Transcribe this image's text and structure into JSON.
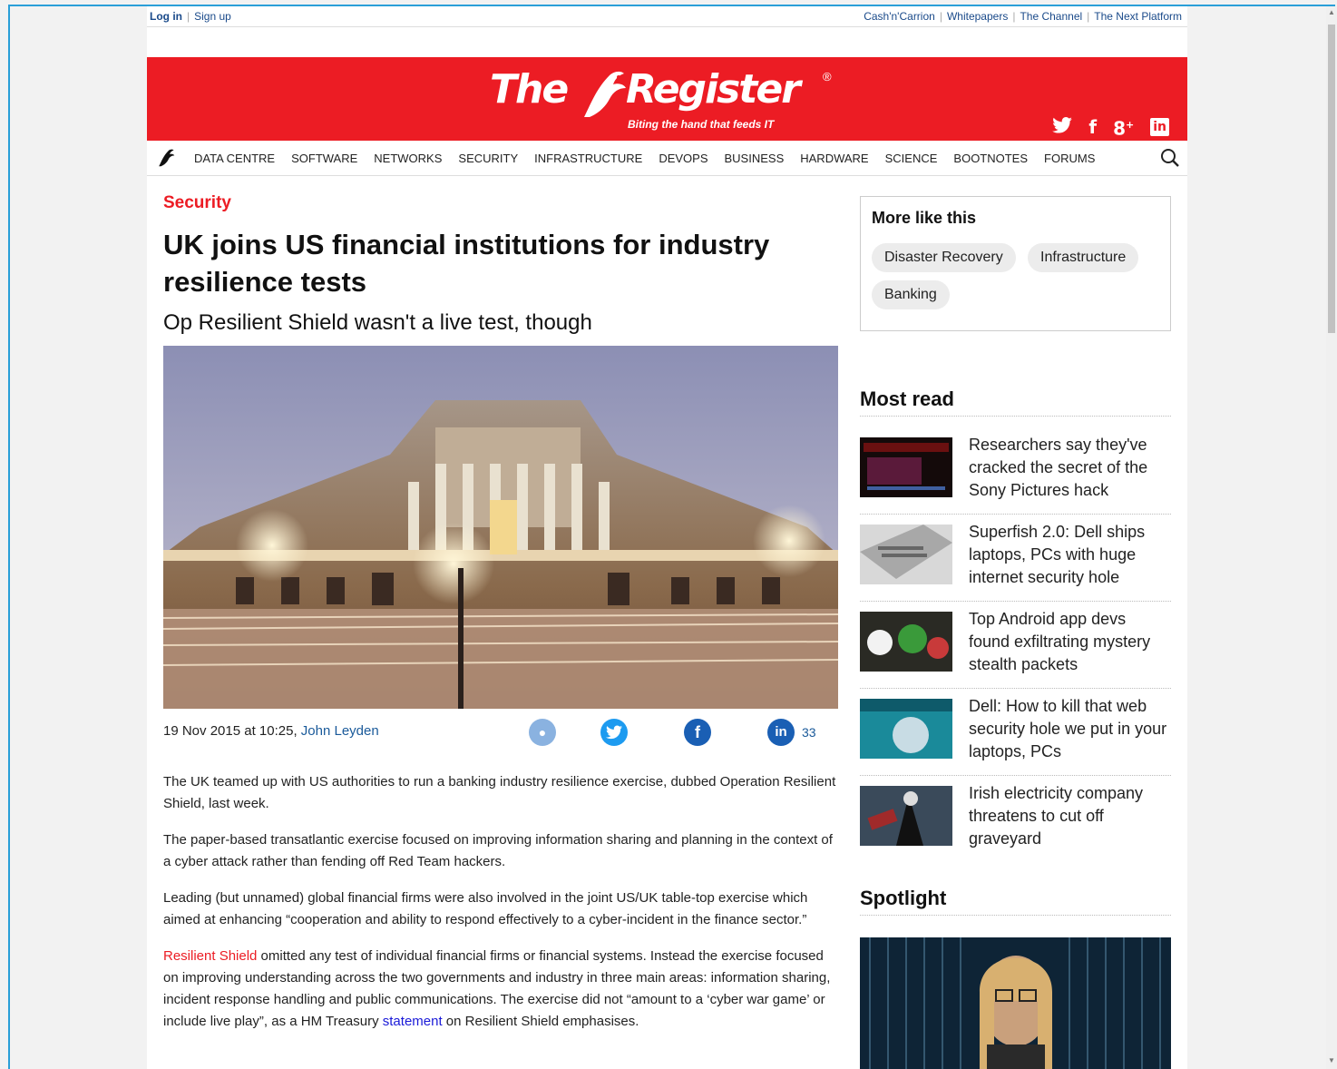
{
  "topbar": {
    "login": "Log in",
    "signup": "Sign up",
    "links": [
      "Cash'n'Carrion",
      "Whitepapers",
      "The Channel",
      "The Next Platform"
    ]
  },
  "logo": {
    "word_the": "The",
    "word_register": "Register",
    "registered": "®",
    "tagline": "Biting the hand that feeds IT"
  },
  "nav": {
    "items": [
      "DATA CENTRE",
      "SOFTWARE",
      "NETWORKS",
      "SECURITY",
      "INFRASTRUCTURE",
      "DEVOPS",
      "BUSINESS",
      "HARDWARE",
      "SCIENCE",
      "BOOTNOTES",
      "FORUMS"
    ]
  },
  "article": {
    "section": "Security",
    "headline": "UK joins US financial institutions for industry resilience tests",
    "standfirst": "Op Resilient Shield wasn't a live test, though",
    "date": "19 Nov 2015 at 10:25,",
    "author": "John Leyden",
    "share_count": "33",
    "p1": "The UK teamed up with US authorities to run a banking industry resilience exercise, dubbed Operation Resilient Shield, last week.",
    "p2": "The paper-based transatlantic exercise focused on improving information sharing and planning in the context of a cyber attack rather than fending off Red Team hackers.",
    "p3": "Leading (but unnamed) global financial firms were also involved in the joint US/UK table-top exercise which aimed at enhancing “cooperation and ability to respond effectively to a cyber-incident in the finance sector.”",
    "p4_link": "Resilient Shield",
    "p4_a": " omitted any test of individual financial firms or financial systems. Instead the exercise focused on improving understanding across the two governments and industry in three main areas: information sharing, incident response handling and public communications. The exercise did not “amount to a ‘cyber war game’ or include live play”, as a HM Treasury ",
    "p4_link2": "statement",
    "p4_b": " on Resilient Shield emphasises."
  },
  "more_like_this": {
    "title": "More like this",
    "tags": [
      "Disaster Recovery",
      "Infrastructure",
      "Banking"
    ]
  },
  "most_read": {
    "title": "Most read",
    "items": [
      "Researchers say they've cracked the secret of the Sony Pictures hack",
      "Superfish 2.0: Dell ships laptops, PCs with huge internet security hole",
      "Top Android app devs found exfiltrating mystery stealth packets",
      "Dell: How to kill that web security hole we put in your laptops, PCs",
      "Irish electricity company threatens to cut off graveyard"
    ]
  },
  "spotlight": {
    "title": "Spotlight"
  },
  "colors": {
    "brand_red": "#ec1c24",
    "link_blue": "#1a5a9a",
    "frame_blue": "#2a9fd8"
  }
}
